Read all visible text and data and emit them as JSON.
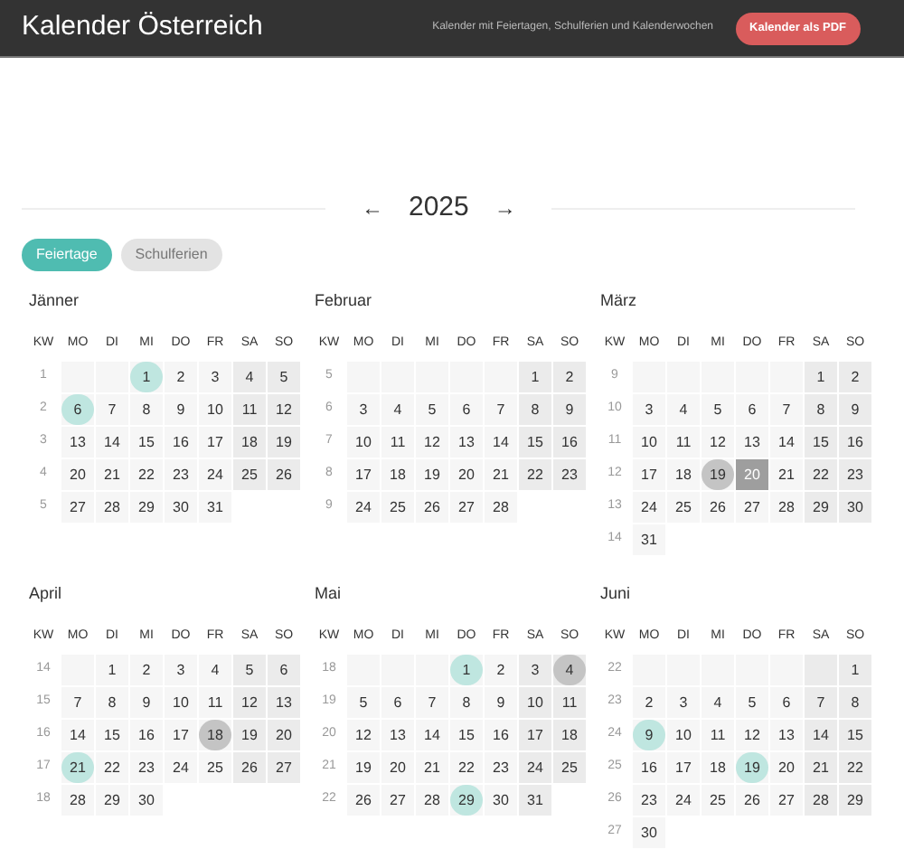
{
  "header": {
    "title": "Kalender Österreich",
    "subtitle": "Kalender mit Feiertagen, Schulferien und Kalenderwochen",
    "pdf_button": "Kalender als PDF"
  },
  "year_nav": {
    "prev": "←",
    "year": "2025",
    "next": "→"
  },
  "filters": [
    {
      "label": "Feiertage",
      "selected": true
    },
    {
      "label": "Schulferien",
      "selected": false
    }
  ],
  "months": [
    {
      "name": "Jänner",
      "weekdays": [
        "KW",
        "MO",
        "DI",
        "MI",
        "DO",
        "FR",
        "SA",
        "SO"
      ],
      "weeks": [
        {
          "kw": "1",
          "days": [
            {
              "kind": "blank"
            },
            {
              "kind": "blank"
            },
            {
              "text": "1",
              "kind": "holiday"
            },
            "2",
            "3",
            "4",
            "5"
          ]
        },
        {
          "kw": "2",
          "days": [
            {
              "text": "6",
              "kind": "holiday"
            },
            "7",
            "8",
            "9",
            "10",
            "11",
            "12"
          ]
        },
        {
          "kw": "3",
          "days": [
            "13",
            "14",
            "15",
            "16",
            "17",
            "18",
            "19"
          ]
        },
        {
          "kw": "4",
          "days": [
            "20",
            "21",
            "22",
            "23",
            "24",
            "25",
            "26"
          ]
        },
        {
          "kw": "5",
          "days": [
            "27",
            "28",
            "29",
            "30",
            "31"
          ]
        }
      ]
    },
    {
      "name": "Februar",
      "weekdays": [
        "KW",
        "MO",
        "DI",
        "MI",
        "DO",
        "FR",
        "SA",
        "SO"
      ],
      "weeks": [
        {
          "kw": "5",
          "days": [
            {
              "kind": "blank"
            },
            {
              "kind": "blank"
            },
            {
              "kind": "blank"
            },
            {
              "kind": "blank"
            },
            {
              "kind": "blank"
            },
            "1",
            "2"
          ]
        },
        {
          "kw": "6",
          "days": [
            "3",
            "4",
            "5",
            "6",
            "7",
            "8",
            "9"
          ]
        },
        {
          "kw": "7",
          "days": [
            "10",
            "11",
            "12",
            "13",
            "14",
            "15",
            "16"
          ]
        },
        {
          "kw": "8",
          "days": [
            "17",
            "18",
            "19",
            "20",
            "21",
            "22",
            "23"
          ]
        },
        {
          "kw": "9",
          "days": [
            "24",
            "25",
            "26",
            "27",
            "28"
          ]
        }
      ]
    },
    {
      "name": "März",
      "weekdays": [
        "KW",
        "MO",
        "DI",
        "MI",
        "DO",
        "FR",
        "SA",
        "SO"
      ],
      "weeks": [
        {
          "kw": "9",
          "days": [
            {
              "kind": "blank"
            },
            {
              "kind": "blank"
            },
            {
              "kind": "blank"
            },
            {
              "kind": "blank"
            },
            {
              "kind": "blank"
            },
            "1",
            "2"
          ]
        },
        {
          "kw": "10",
          "days": [
            "3",
            "4",
            "5",
            "6",
            "7",
            "8",
            "9"
          ]
        },
        {
          "kw": "11",
          "days": [
            "10",
            "11",
            "12",
            "13",
            "14",
            "15",
            "16"
          ]
        },
        {
          "kw": "12",
          "days": [
            "17",
            "18",
            {
              "text": "19",
              "kind": "marked"
            },
            {
              "text": "20",
              "kind": "current"
            },
            "21",
            "22",
            "23"
          ]
        },
        {
          "kw": "13",
          "days": [
            "24",
            "25",
            "26",
            "27",
            "28",
            "29",
            "30"
          ]
        },
        {
          "kw": "14",
          "days": [
            "31"
          ]
        }
      ]
    },
    {
      "name": "April",
      "weekdays": [
        "KW",
        "MO",
        "DI",
        "MI",
        "DO",
        "FR",
        "SA",
        "SO"
      ],
      "weeks": [
        {
          "kw": "14",
          "days": [
            {
              "kind": "blank"
            },
            "1",
            "2",
            "3",
            "4",
            "5",
            "6"
          ]
        },
        {
          "kw": "15",
          "days": [
            "7",
            "8",
            "9",
            "10",
            "11",
            "12",
            "13"
          ]
        },
        {
          "kw": "16",
          "days": [
            "14",
            "15",
            "16",
            "17",
            {
              "text": "18",
              "kind": "marked"
            },
            "19",
            "20"
          ]
        },
        {
          "kw": "17",
          "days": [
            {
              "text": "21",
              "kind": "holiday"
            },
            "22",
            "23",
            "24",
            "25",
            "26",
            "27"
          ]
        },
        {
          "kw": "18",
          "days": [
            "28",
            "29",
            "30"
          ]
        }
      ]
    },
    {
      "name": "Mai",
      "weekdays": [
        "KW",
        "MO",
        "DI",
        "MI",
        "DO",
        "FR",
        "SA",
        "SO"
      ],
      "weeks": [
        {
          "kw": "18",
          "days": [
            {
              "kind": "blank"
            },
            {
              "kind": "blank"
            },
            {
              "kind": "blank"
            },
            {
              "text": "1",
              "kind": "holiday"
            },
            "2",
            "3",
            {
              "text": "4",
              "kind": "marked"
            }
          ]
        },
        {
          "kw": "19",
          "days": [
            "5",
            "6",
            "7",
            "8",
            "9",
            "10",
            "11"
          ]
        },
        {
          "kw": "20",
          "days": [
            "12",
            "13",
            "14",
            "15",
            "16",
            "17",
            "18"
          ]
        },
        {
          "kw": "21",
          "days": [
            "19",
            "20",
            "21",
            "22",
            "23",
            "24",
            "25"
          ]
        },
        {
          "kw": "22",
          "days": [
            "26",
            "27",
            "28",
            {
              "text": "29",
              "kind": "holiday"
            },
            "30",
            "31"
          ]
        }
      ]
    },
    {
      "name": "Juni",
      "weekdays": [
        "KW",
        "MO",
        "DI",
        "MI",
        "DO",
        "FR",
        "SA",
        "SO"
      ],
      "weeks": [
        {
          "kw": "22",
          "days": [
            {
              "kind": "blank"
            },
            {
              "kind": "blank"
            },
            {
              "kind": "blank"
            },
            {
              "kind": "blank"
            },
            {
              "kind": "blank"
            },
            {
              "kind": "blank"
            },
            "1"
          ]
        },
        {
          "kw": "23",
          "days": [
            "2",
            "3",
            "4",
            "5",
            "6",
            "7",
            "8"
          ]
        },
        {
          "kw": "24",
          "days": [
            {
              "text": "9",
              "kind": "holiday"
            },
            "10",
            "11",
            "12",
            "13",
            "14",
            "15"
          ]
        },
        {
          "kw": "25",
          "days": [
            "16",
            "17",
            "18",
            {
              "text": "19",
              "kind": "holiday"
            },
            "20",
            "21",
            "22"
          ]
        },
        {
          "kw": "26",
          "days": [
            "23",
            "24",
            "25",
            "26",
            "27",
            "28",
            "29"
          ]
        },
        {
          "kw": "27",
          "days": [
            "30"
          ]
        }
      ]
    }
  ]
}
